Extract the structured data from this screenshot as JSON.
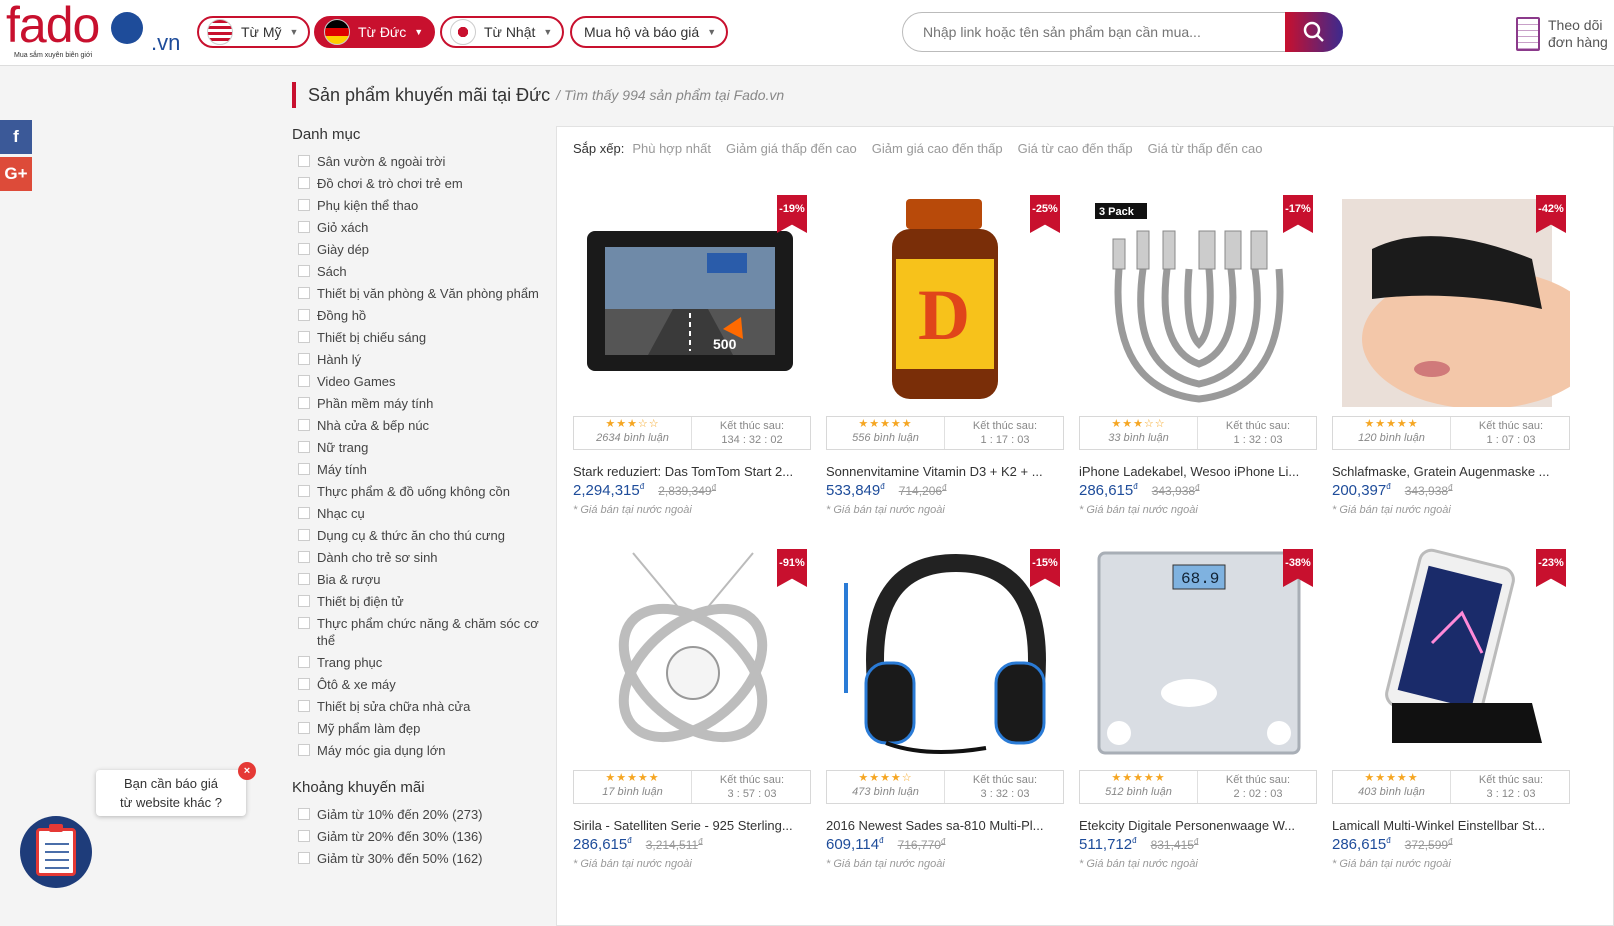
{
  "header": {
    "logo": {
      "wordmark": "fado",
      "tld": ".vn",
      "tagline": "Mua sắm xuyên biên giới"
    },
    "origins": [
      {
        "label": "Từ Mỹ",
        "flag": "us",
        "active": false
      },
      {
        "label": "Từ Đức",
        "flag": "de",
        "active": true
      },
      {
        "label": "Từ Nhật",
        "flag": "jp",
        "active": false
      }
    ],
    "service": {
      "label": "Mua hộ và báo giá"
    },
    "search": {
      "placeholder": "Nhập link hoặc tên sản phẩm bạn cần mua...",
      "value": ""
    },
    "track_orders": {
      "line1": "Theo dõi",
      "line2": "đơn hàng"
    }
  },
  "social": {
    "facebook": "f",
    "google_plus": "G+"
  },
  "breadcrumb": {
    "title": "Sản phẩm khuyến mãi tại Đức",
    "subtitle": "/ Tìm thấy 994 sản phẩm tại Fado.vn"
  },
  "sidebar": {
    "category_heading": "Danh mục",
    "categories": [
      "Sân vườn & ngoài trời",
      "Đồ chơi & trò chơi trẻ em",
      "Phụ kiện thể thao",
      "Giỏ xách",
      "Giày dép",
      "Sách",
      "Thiết bị văn phòng & Văn phòng phẩm",
      "Đồng hồ",
      "Thiết bị chiếu sáng",
      "Hành lý",
      "Video Games",
      "Phần mềm máy tính",
      "Nhà cửa & bếp núc",
      "Nữ trang",
      "Máy tính",
      "Thực phẩm & đồ uống không cồn",
      "Nhạc cụ",
      "Dụng cụ & thức ăn cho thú cưng",
      "Dành cho trẻ sơ sinh",
      "Bia & rượu",
      "Thiết bị điện tử",
      "Thực phẩm chức năng & chăm sóc cơ thể",
      "Trang phục",
      "Ôtô & xe máy",
      "Thiết bị sửa chữa nhà cửa",
      "Mỹ phẩm làm đẹp",
      "Máy móc gia dụng lớn"
    ],
    "discount_heading": "Khoảng khuyến mãi",
    "discounts": [
      "Giảm từ 10% đến 20% (273)",
      "Giảm từ 20% đến 30% (136)",
      "Giảm từ 30% đến 50% (162)"
    ]
  },
  "sort": {
    "label": "Sắp xếp:",
    "options": [
      "Phù hợp nhất",
      "Giảm giá thấp đến cao",
      "Giảm giá cao đến thấp",
      "Giá từ cao đến thấp",
      "Giá từ thấp đến cao"
    ]
  },
  "card_labels": {
    "ends": "Kết thúc sau:",
    "note": "* Giá bán tại nước ngoài",
    "currency": "đ"
  },
  "products": [
    {
      "discount": "-19%",
      "stars": "★★★☆☆",
      "reviews": "2634 bình luận",
      "timer": "134 : 32 : 02",
      "name": "Stark reduziert: Das TomTom Start 2...",
      "price": "2,294,315",
      "old_price": "2,839,349",
      "image": "gps-navigator"
    },
    {
      "discount": "-25%",
      "stars": "★★★★★",
      "reviews": "556 bình luận",
      "timer": "1 : 17 : 03",
      "name": "Sonnenvitamine Vitamin D3 + K2 + ...",
      "price": "533,849",
      "old_price": "714,206",
      "image": "vitamin-bottle"
    },
    {
      "discount": "-17%",
      "stars": "★★★☆☆",
      "reviews": "33 bình luận",
      "timer": "1 : 32 : 03",
      "name": "iPhone Ladekabel, Wesoo iPhone Li...",
      "price": "286,615",
      "old_price": "343,938",
      "image": "cables-3pack"
    },
    {
      "discount": "-42%",
      "stars": "★★★★★",
      "reviews": "120 bình luận",
      "timer": "1 : 07 : 03",
      "name": "Schlafmaske, Gratein Augenmaske ...",
      "price": "200,397",
      "old_price": "343,938",
      "image": "sleep-mask"
    },
    {
      "discount": "-91%",
      "stars": "★★★★★",
      "reviews": "17 bình luận",
      "timer": "3 : 57 : 03",
      "name": "Sirila - Satelliten Serie - 925 Sterling...",
      "price": "286,615",
      "old_price": "3,214,511",
      "image": "necklace"
    },
    {
      "discount": "-15%",
      "stars": "★★★★☆",
      "reviews": "473 bình luận",
      "timer": "3 : 32 : 03",
      "name": "2016 Newest Sades sa-810 Multi-Pl...",
      "price": "609,114",
      "old_price": "716,770",
      "image": "headset"
    },
    {
      "discount": "-38%",
      "stars": "★★★★★",
      "reviews": "512 bình luận",
      "timer": "2 : 02 : 03",
      "name": "Etekcity Digitale Personenwaage W...",
      "price": "511,712",
      "old_price": "831,415",
      "image": "bathroom-scale"
    },
    {
      "discount": "-23%",
      "stars": "★★★★★",
      "reviews": "403 bình luận",
      "timer": "3 : 12 : 03",
      "name": "Lamicall Multi-Winkel Einstellbar St...",
      "price": "286,615",
      "old_price": "372,599",
      "image": "phone-stand"
    }
  ],
  "chat": {
    "bubble_line1": "Bạn cần báo giá",
    "bubble_line2": "từ website khác ?",
    "close": "×"
  },
  "colors": {
    "brand_red": "#c8102e",
    "brand_blue": "#1e4c9a",
    "price_blue": "#1e4c9a",
    "star": "#f5a623"
  }
}
